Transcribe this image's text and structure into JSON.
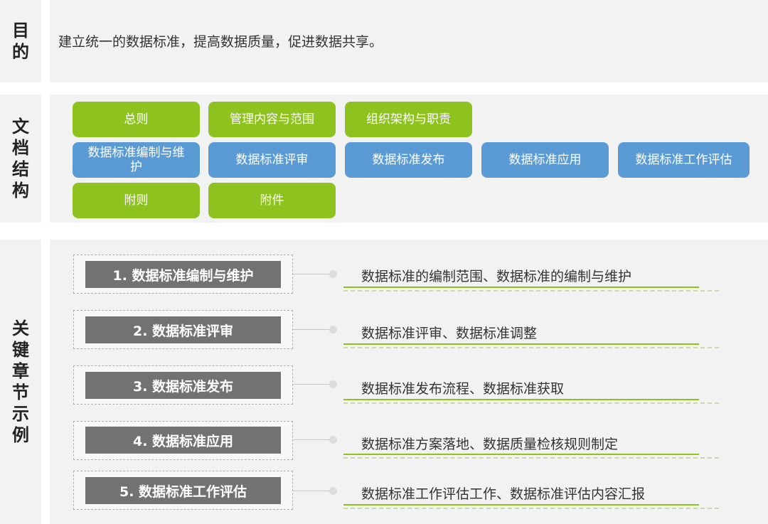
{
  "purpose": {
    "label": [
      "目",
      "的"
    ],
    "text": "建立统一的数据标准，提高数据质量，促进数据共享。"
  },
  "structure": {
    "label": [
      "文",
      "档",
      "结",
      "构"
    ],
    "tags": [
      {
        "text": "总则",
        "color": "green"
      },
      {
        "text": "管理内容与范围",
        "color": "green"
      },
      {
        "text": "组织架构与职责",
        "color": "green"
      },
      {
        "text": "数据标准编制与维护",
        "color": "blue"
      },
      {
        "text": "数据标准评审",
        "color": "blue"
      },
      {
        "text": "数据标准发布",
        "color": "blue"
      },
      {
        "text": "数据标准应用",
        "color": "blue"
      },
      {
        "text": "数据标准工作评估",
        "color": "blue"
      },
      {
        "text": "附则",
        "color": "green"
      },
      {
        "text": "附件",
        "color": "green"
      }
    ]
  },
  "chapters": {
    "label": [
      "关",
      "键",
      "章",
      "节",
      "示",
      "例"
    ],
    "items": [
      {
        "title": "1. 数据标准编制与维护",
        "desc": "数据标准的编制范围、数据标准的编制与维护"
      },
      {
        "title": "2. 数据标准评审",
        "desc": "数据标准评审、数据标准调整"
      },
      {
        "title": "3. 数据标准发布",
        "desc": "数据标准发布流程、数据标准获取"
      },
      {
        "title": "4. 数据标准应用",
        "desc": "数据标准方案落地、数据质量检核规则制定"
      },
      {
        "title": "5. 数据标准工作评估",
        "desc": "数据标准工作评估工作、数据标准评估内容汇报"
      }
    ]
  },
  "colors": {
    "green": "#8dc21f",
    "blue": "#5b9bd5",
    "panel": "#f2f2f2",
    "chapter_box": "#727272"
  }
}
